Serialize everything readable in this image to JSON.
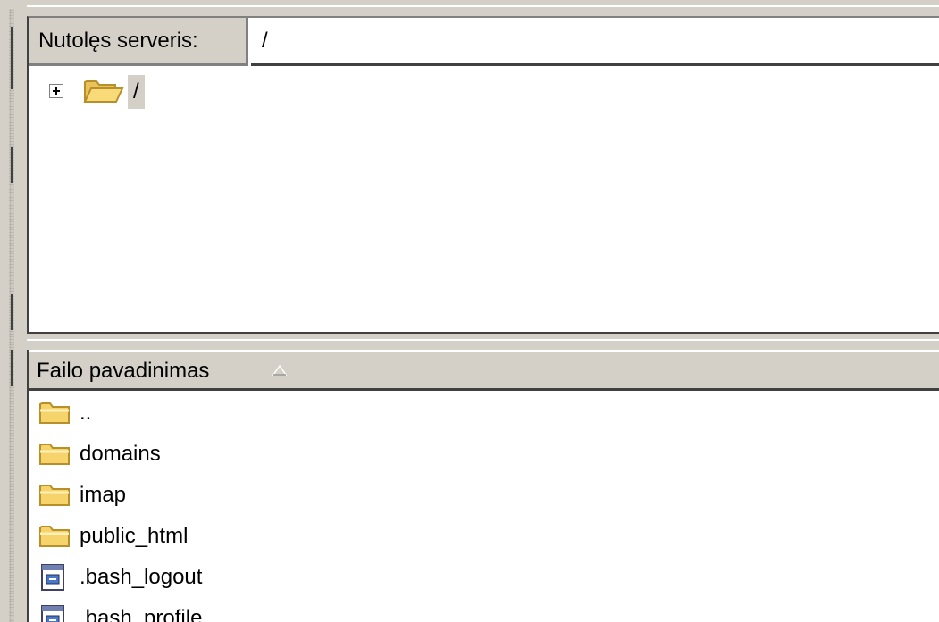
{
  "remote_site": {
    "label": "Nutolęs serveris:",
    "path_value": "/",
    "tree": [
      {
        "label": "/",
        "icon": "folder-open-icon",
        "expander": "plus"
      }
    ]
  },
  "file_list": {
    "column_header": "Failo pavadinimas",
    "sort_indicator": "sort-ascending-icon",
    "items": [
      {
        "name": "..",
        "icon": "folder-icon"
      },
      {
        "name": "domains",
        "icon": "folder-icon"
      },
      {
        "name": "imap",
        "icon": "folder-icon"
      },
      {
        "name": "public_html",
        "icon": "folder-icon"
      },
      {
        "name": ".bash_logout",
        "icon": "file-icon"
      },
      {
        "name": ".bash_profile",
        "icon": "file-icon"
      }
    ]
  },
  "colors": {
    "chrome": "#d4d0c8",
    "folder_fill": "#f6d36b",
    "folder_stroke": "#b8902a",
    "panel_bg": "#ffffff"
  }
}
